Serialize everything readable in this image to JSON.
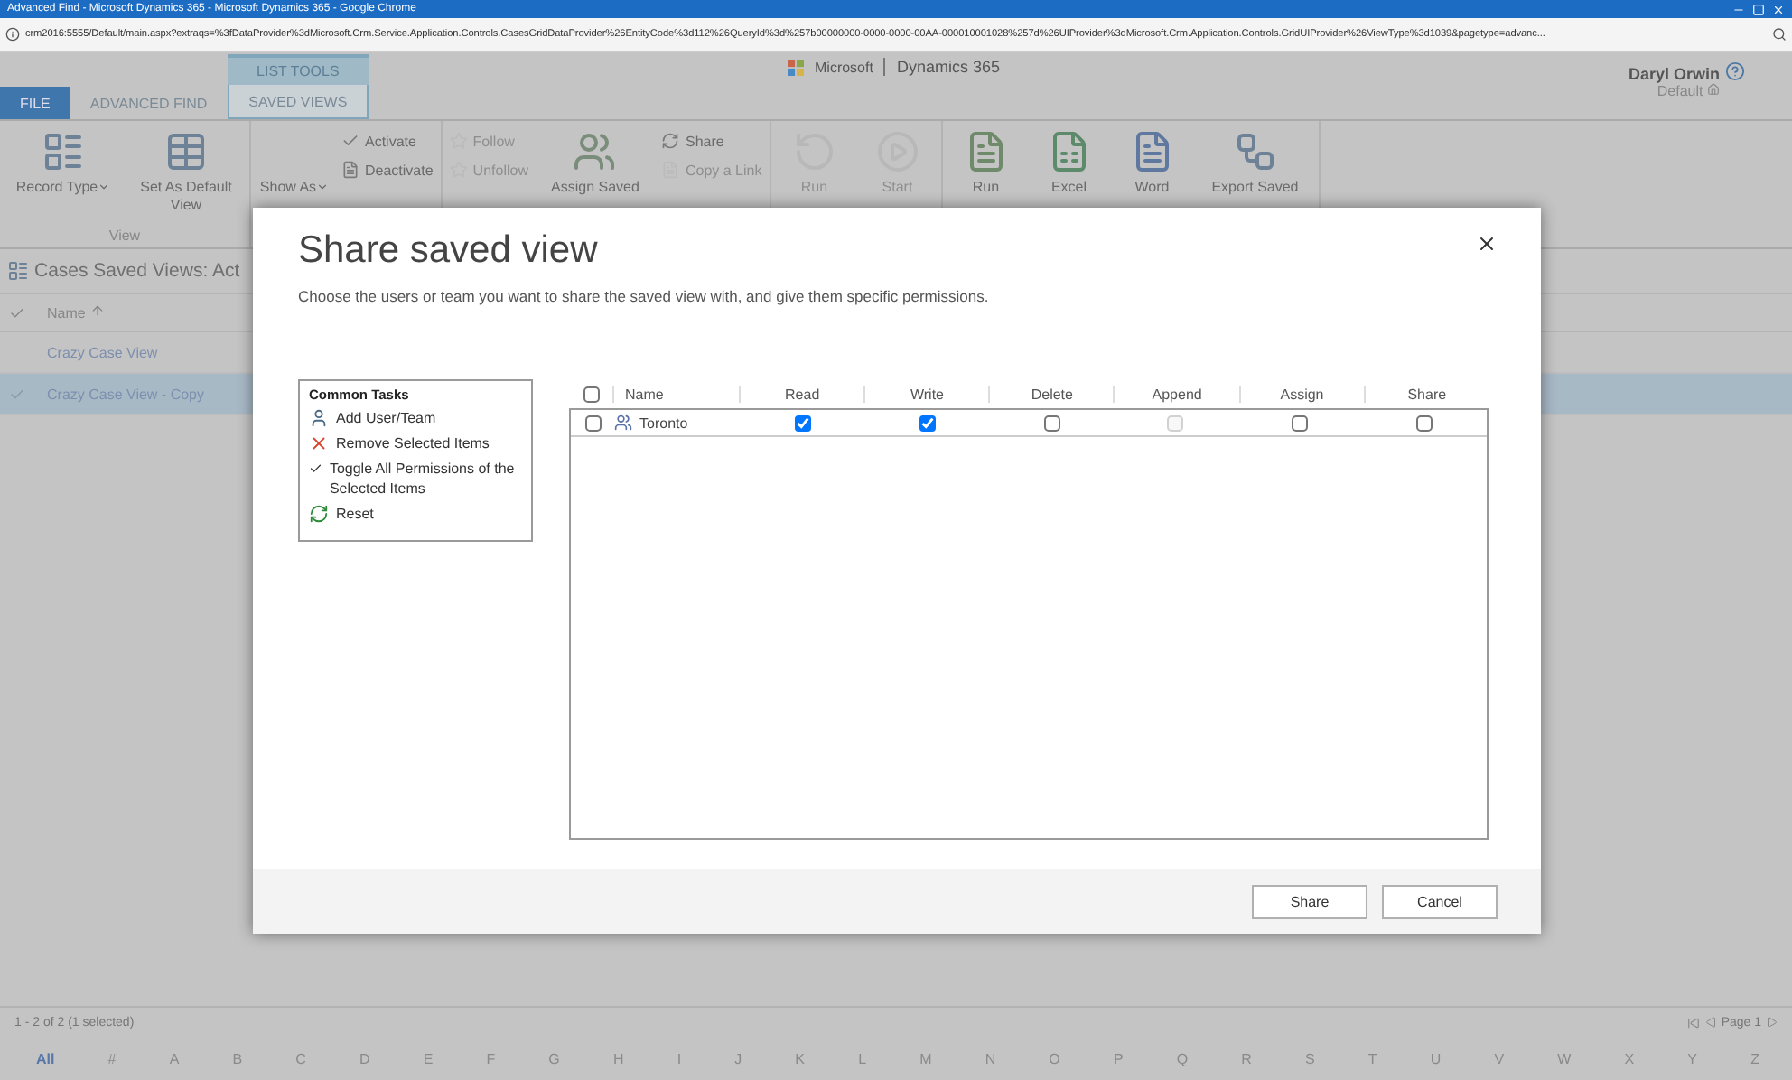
{
  "browser": {
    "title": "Advanced Find - Microsoft Dynamics 365 - Microsoft Dynamics 365 - Google Chrome",
    "url": "crm2016:5555/Default/main.aspx?extraqs=%3fDataProvider%3dMicrosoft.Crm.Service.Application.Controls.CasesGridDataProvider%26EntityCode%3d112%26QueryId%3d%257b00000000-0000-0000-00AA-000010001028%257d%26UIProvider%3dMicrosoft.Crm.Application.Controls.GridUIProvider%26ViewType%3d1039&pagetype=advanc..."
  },
  "header": {
    "context_tab": "LIST TOOLS",
    "tabs": [
      {
        "label": "FILE",
        "kind": "file",
        "selected": false
      },
      {
        "label": "ADVANCED FIND",
        "kind": "tab",
        "selected": false
      },
      {
        "label": "SAVED VIEWS",
        "kind": "tab",
        "selected": true
      }
    ],
    "brand": "Microsoft",
    "product": "Dynamics 365",
    "user": "Daryl Orwin",
    "org": "Default"
  },
  "ribbon": [
    {
      "label": "View",
      "items": [
        {
          "kind": "large",
          "label": "Record Type",
          "dropdown": true,
          "disabled": false
        },
        {
          "kind": "large",
          "label": "Set As Default View",
          "dropdown": false,
          "disabled": false
        }
      ]
    },
    {
      "items": [
        {
          "kind": "large",
          "label": "Show As",
          "dropdown": true,
          "disabled": false
        },
        {
          "kind": "stack",
          "items": [
            {
              "label": "Activate",
              "disabled": false
            },
            {
              "label": "Deactivate",
              "disabled": false
            }
          ]
        }
      ]
    },
    {
      "items": [
        {
          "kind": "stack",
          "items": [
            {
              "label": "Follow",
              "disabled": true
            },
            {
              "label": "Unfollow",
              "disabled": true
            }
          ]
        },
        {
          "kind": "large",
          "label": "Assign Saved",
          "dropdown": false,
          "disabled": false
        },
        {
          "kind": "stack",
          "items": [
            {
              "label": "Share",
              "disabled": false
            },
            {
              "label": "Copy a Link",
              "disabled": true
            }
          ]
        }
      ]
    },
    {
      "items": [
        {
          "kind": "large",
          "label": "Run",
          "dropdown": false,
          "disabled": true
        },
        {
          "kind": "large",
          "label": "Start",
          "dropdown": false,
          "disabled": true
        }
      ]
    },
    {
      "items": [
        {
          "kind": "large",
          "label": "Run",
          "dropdown": false,
          "disabled": false
        },
        {
          "kind": "large",
          "label": "Excel",
          "dropdown": false,
          "disabled": false
        },
        {
          "kind": "large",
          "label": "Word",
          "dropdown": false,
          "disabled": false
        },
        {
          "kind": "large",
          "label": "Export Saved",
          "dropdown": false,
          "disabled": false
        }
      ]
    }
  ],
  "list": {
    "title": "Cases Saved Views: Act",
    "column": "Name",
    "rows": [
      {
        "name": "Crazy Case View",
        "selected": false
      },
      {
        "name": "Crazy Case View - Copy",
        "selected": true
      }
    ],
    "status": "1 - 2 of 2 (1 selected)",
    "page": "Page 1",
    "letters": [
      {
        "label": "All",
        "selected": true
      },
      {
        "label": "#",
        "selected": false
      },
      {
        "label": "A",
        "selected": false
      },
      {
        "label": "B",
        "selected": false
      },
      {
        "label": "C",
        "selected": false
      },
      {
        "label": "D",
        "selected": false
      },
      {
        "label": "E",
        "selected": false
      },
      {
        "label": "F",
        "selected": false
      },
      {
        "label": "G",
        "selected": false
      },
      {
        "label": "H",
        "selected": false
      },
      {
        "label": "I",
        "selected": false
      },
      {
        "label": "J",
        "selected": false
      },
      {
        "label": "K",
        "selected": false
      },
      {
        "label": "L",
        "selected": false
      },
      {
        "label": "M",
        "selected": false
      },
      {
        "label": "N",
        "selected": false
      },
      {
        "label": "O",
        "selected": false
      },
      {
        "label": "P",
        "selected": false
      },
      {
        "label": "Q",
        "selected": false
      },
      {
        "label": "R",
        "selected": false
      },
      {
        "label": "S",
        "selected": false
      },
      {
        "label": "T",
        "selected": false
      },
      {
        "label": "U",
        "selected": false
      },
      {
        "label": "V",
        "selected": false
      },
      {
        "label": "W",
        "selected": false
      },
      {
        "label": "X",
        "selected": false
      },
      {
        "label": "Y",
        "selected": false
      },
      {
        "label": "Z",
        "selected": false
      }
    ]
  },
  "dialog": {
    "title": "Share saved view",
    "subtitle": "Choose the users or team you want to share the saved view with, and give them specific permissions.",
    "tasks_title": "Common Tasks",
    "tasks": [
      {
        "kind": "user",
        "label": "Add User/Team"
      },
      {
        "kind": "remove",
        "label": "Remove Selected Items"
      },
      {
        "kind": "toggle",
        "label": "Toggle All Permissions of the Selected Items"
      },
      {
        "kind": "reset",
        "label": "Reset"
      }
    ],
    "columns": [
      "Name",
      "Read",
      "Write",
      "Delete",
      "Append",
      "Assign",
      "Share"
    ],
    "select_all": false,
    "rows": [
      {
        "name": "Toronto",
        "kind": "team",
        "selected": false,
        "permissions": [
          {
            "checked": true,
            "disabled": false
          },
          {
            "checked": true,
            "disabled": false
          },
          {
            "checked": false,
            "disabled": false
          },
          {
            "checked": false,
            "disabled": true
          },
          {
            "checked": false,
            "disabled": false
          },
          {
            "checked": false,
            "disabled": false
          }
        ]
      }
    ],
    "buttons": [
      "Share",
      "Cancel"
    ]
  }
}
